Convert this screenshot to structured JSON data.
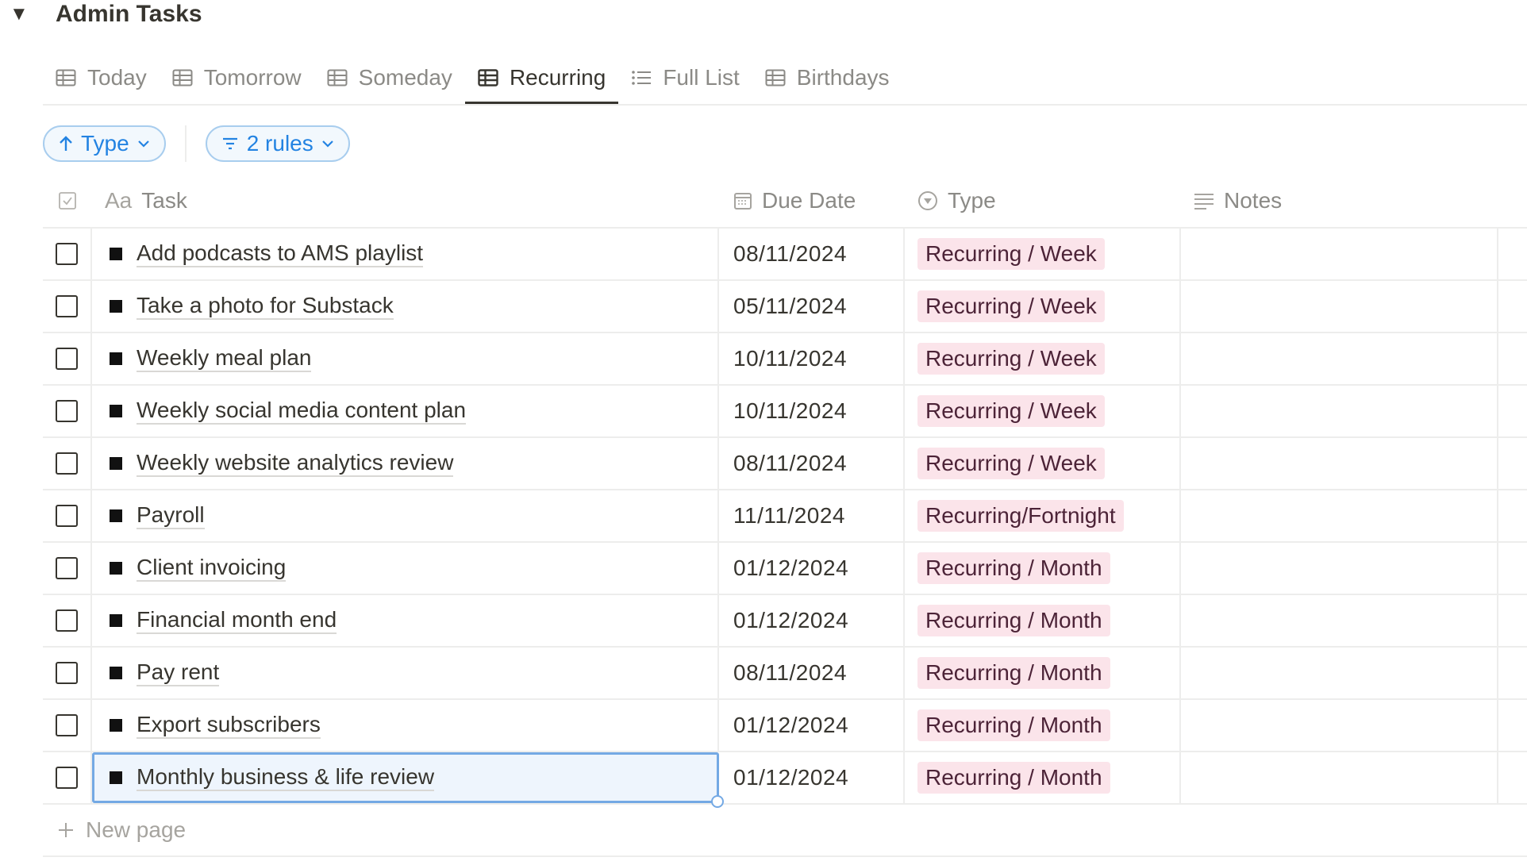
{
  "database": {
    "toggle_icon": "triangle-down-icon",
    "title": "Admin Tasks"
  },
  "tabs": [
    {
      "label": "Today",
      "icon": "table-icon",
      "active": false
    },
    {
      "label": "Tomorrow",
      "icon": "table-icon",
      "active": false
    },
    {
      "label": "Someday",
      "icon": "table-icon",
      "active": false
    },
    {
      "label": "Recurring",
      "icon": "table-icon",
      "active": true
    },
    {
      "label": "Full List",
      "icon": "list-icon",
      "active": false
    },
    {
      "label": "Birthdays",
      "icon": "table-icon",
      "active": false
    }
  ],
  "filters": {
    "sort_label": "Type",
    "rules_label": "2 rules"
  },
  "columns": {
    "task_prefix": "Aa",
    "task": "Task",
    "due_date": "Due Date",
    "type": "Type",
    "notes": "Notes"
  },
  "rows": [
    {
      "task": "Add podcasts to AMS playlist",
      "due": "08/11/2024",
      "type": "Recurring / Week",
      "notes": ""
    },
    {
      "task": "Take a photo for Substack",
      "due": "05/11/2024",
      "type": "Recurring / Week",
      "notes": ""
    },
    {
      "task": "Weekly meal plan",
      "due": "10/11/2024",
      "type": "Recurring / Week",
      "notes": ""
    },
    {
      "task": "Weekly social media content plan",
      "due": "10/11/2024",
      "type": "Recurring / Week",
      "notes": ""
    },
    {
      "task": "Weekly website analytics review",
      "due": "08/11/2024",
      "type": "Recurring / Week",
      "notes": ""
    },
    {
      "task": "Payroll",
      "due": "11/11/2024",
      "type": "Recurring/Fortnight",
      "notes": ""
    },
    {
      "task": "Client invoicing",
      "due": "01/12/2024",
      "type": "Recurring / Month",
      "notes": ""
    },
    {
      "task": "Financial month end",
      "due": "01/12/2024",
      "type": "Recurring / Month",
      "notes": ""
    },
    {
      "task": "Pay rent",
      "due": "08/11/2024",
      "type": "Recurring / Month",
      "notes": ""
    },
    {
      "task": "Export subscribers",
      "due": "01/12/2024",
      "type": "Recurring / Month",
      "notes": ""
    },
    {
      "task": "Monthly business & life review",
      "due": "01/12/2024",
      "type": "Recurring / Month",
      "notes": "",
      "selected": true
    }
  ],
  "new_page_label": "New page",
  "colors": {
    "accent": "#2383e2",
    "tag_bg": "#fbe4ea",
    "tag_text": "#4c2337",
    "selection_border": "#74a9e4"
  }
}
